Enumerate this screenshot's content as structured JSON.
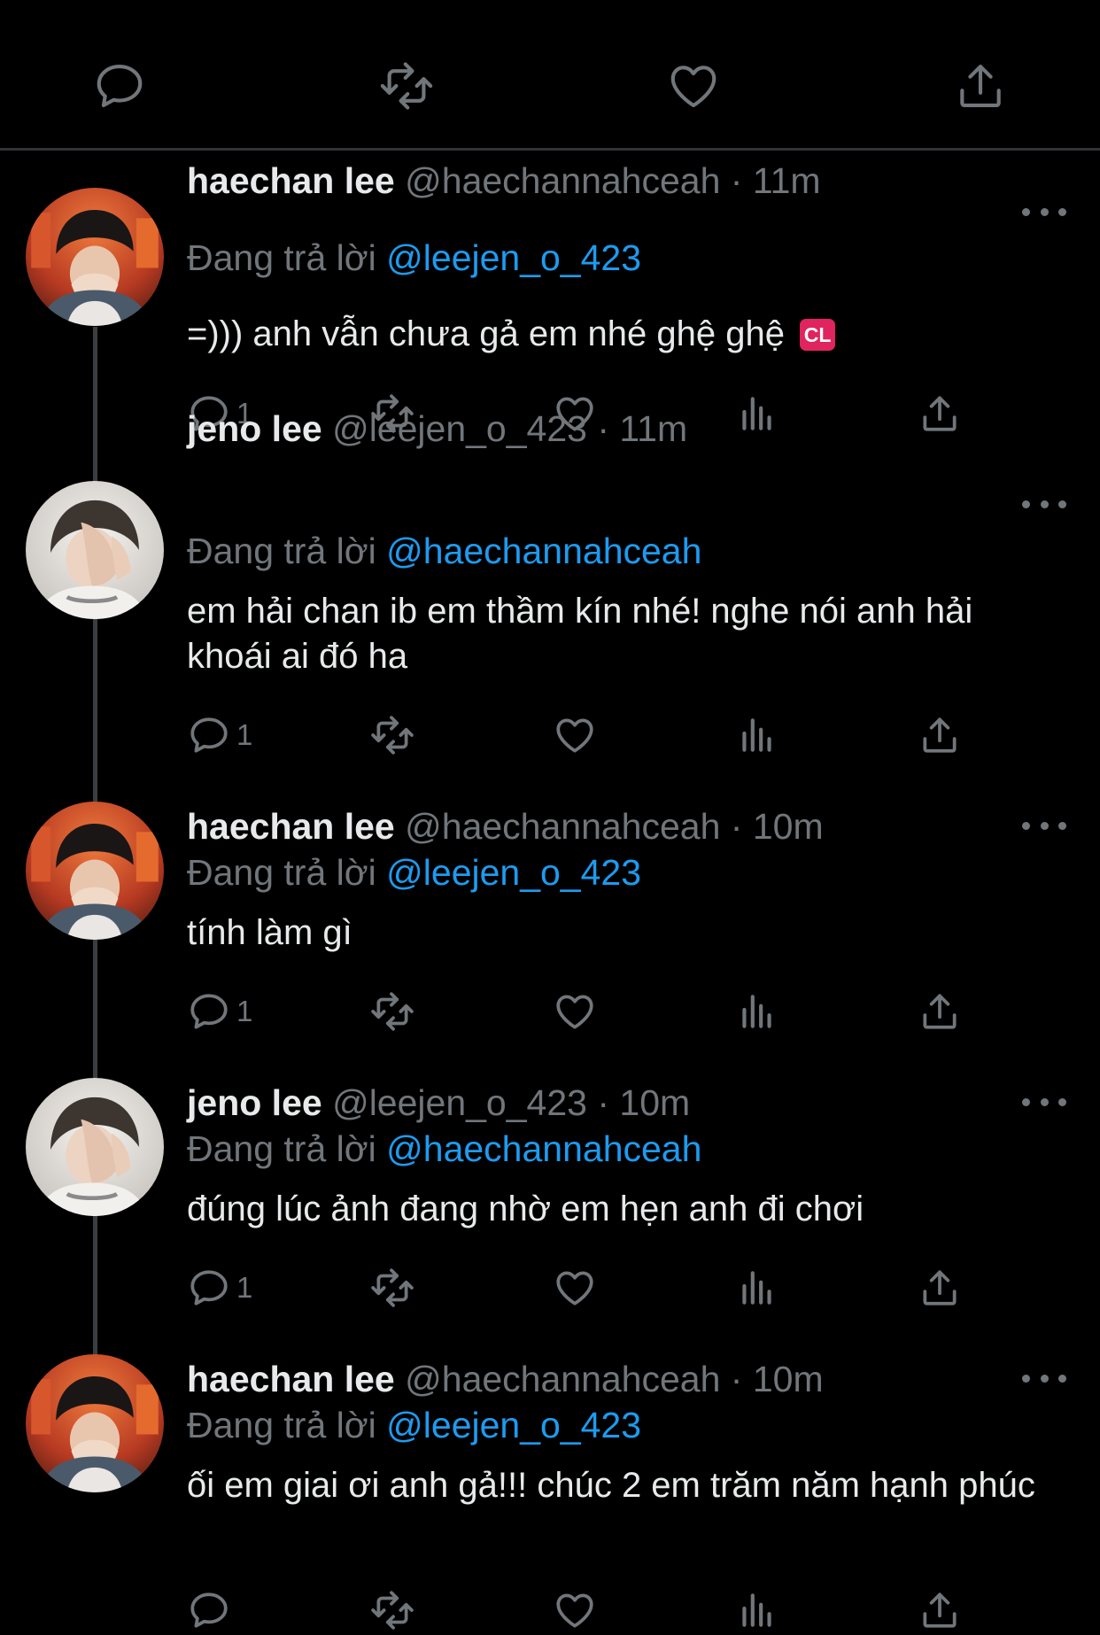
{
  "colors": {
    "background": "#000000",
    "text": "#e7e9ea",
    "muted": "#71767b",
    "link": "#1d9bf0",
    "divider": "#2f3336",
    "badge": "#e0245e"
  },
  "top_actions": {
    "icons": [
      "reply-icon",
      "retweet-icon",
      "like-icon",
      "share-icon"
    ]
  },
  "tweets": [
    {
      "name": "haechan lee",
      "handle": "@haechannahceah",
      "separator": "·",
      "time": "11m",
      "reply_label": "Đang trả lời",
      "reply_to": "@leejen_o_423",
      "text": "=))) anh vẫn chưa gả em nhé ghệ ghệ",
      "badge": "CL",
      "reply_count": "1",
      "avatar": "haechan"
    },
    {
      "name": "jeno lee",
      "handle": "@leejen_o_423",
      "separator": "·",
      "time": "11m",
      "reply_label": "Đang trả lời",
      "reply_to": "@haechannahceah",
      "text": "em hải chan ib em thầm kín nhé! nghe nói anh hải khoái ai đó ha",
      "reply_count": "1",
      "avatar": "jeno"
    },
    {
      "name": "haechan lee",
      "handle": "@haechannahceah",
      "separator": "·",
      "time": "10m",
      "reply_label": "Đang trả lời",
      "reply_to": "@leejen_o_423",
      "text": "tính làm gì",
      "reply_count": "1",
      "avatar": "haechan"
    },
    {
      "name": "jeno lee",
      "handle": "@leejen_o_423",
      "separator": "·",
      "time": "10m",
      "reply_label": "Đang trả lời",
      "reply_to": "@haechannahceah",
      "text": "đúng lúc ảnh đang nhờ em hẹn anh đi chơi",
      "reply_count": "1",
      "avatar": "jeno"
    },
    {
      "name": "haechan lee",
      "handle": "@haechannahceah",
      "separator": "·",
      "time": "10m",
      "reply_label": "Đang trả lời",
      "reply_to": "@leejen_o_423",
      "text": "ối em giai ơi anh gả!!! chúc 2 em trăm năm hạnh phúc",
      "reply_count": "",
      "avatar": "haechan"
    }
  ]
}
